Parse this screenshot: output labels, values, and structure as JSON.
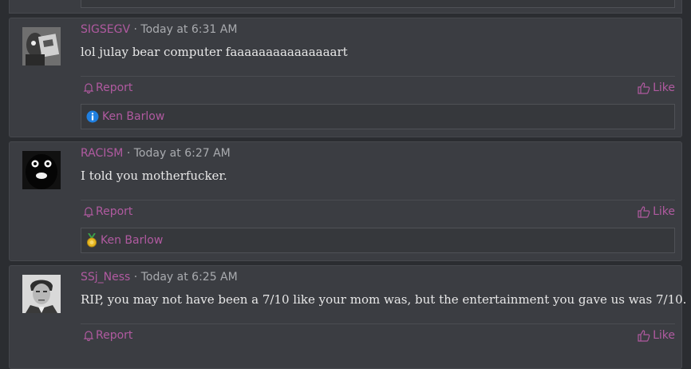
{
  "posts": [
    {
      "username": "SIGSEGV",
      "time": "Today at 6:31 AM",
      "message": "lol julay bear computer faaaaaaaaaaaaaaart",
      "report_label": "Report",
      "like_label": "Like",
      "reaction_user": "Ken Barlow",
      "reaction_icon": "info-icon"
    },
    {
      "username": "RACISM",
      "time": "Today at 6:27 AM",
      "message": "I told you motherfucker.",
      "report_label": "Report",
      "like_label": "Like",
      "reaction_user": "Ken Barlow",
      "reaction_icon": "medal-icon"
    },
    {
      "username": "SSj_Ness",
      "time": "Today at 6:25 AM",
      "message": "RIP, you may not have been a 7/10 like your mom was, but the entertainment you gave us was 7/10.",
      "report_label": "Report",
      "like_label": "Like"
    }
  ],
  "meta_separator": "·",
  "colors": {
    "accent": "#b05aa0",
    "post_bg": "#3b3d42",
    "page_bg": "#2b2d31"
  }
}
